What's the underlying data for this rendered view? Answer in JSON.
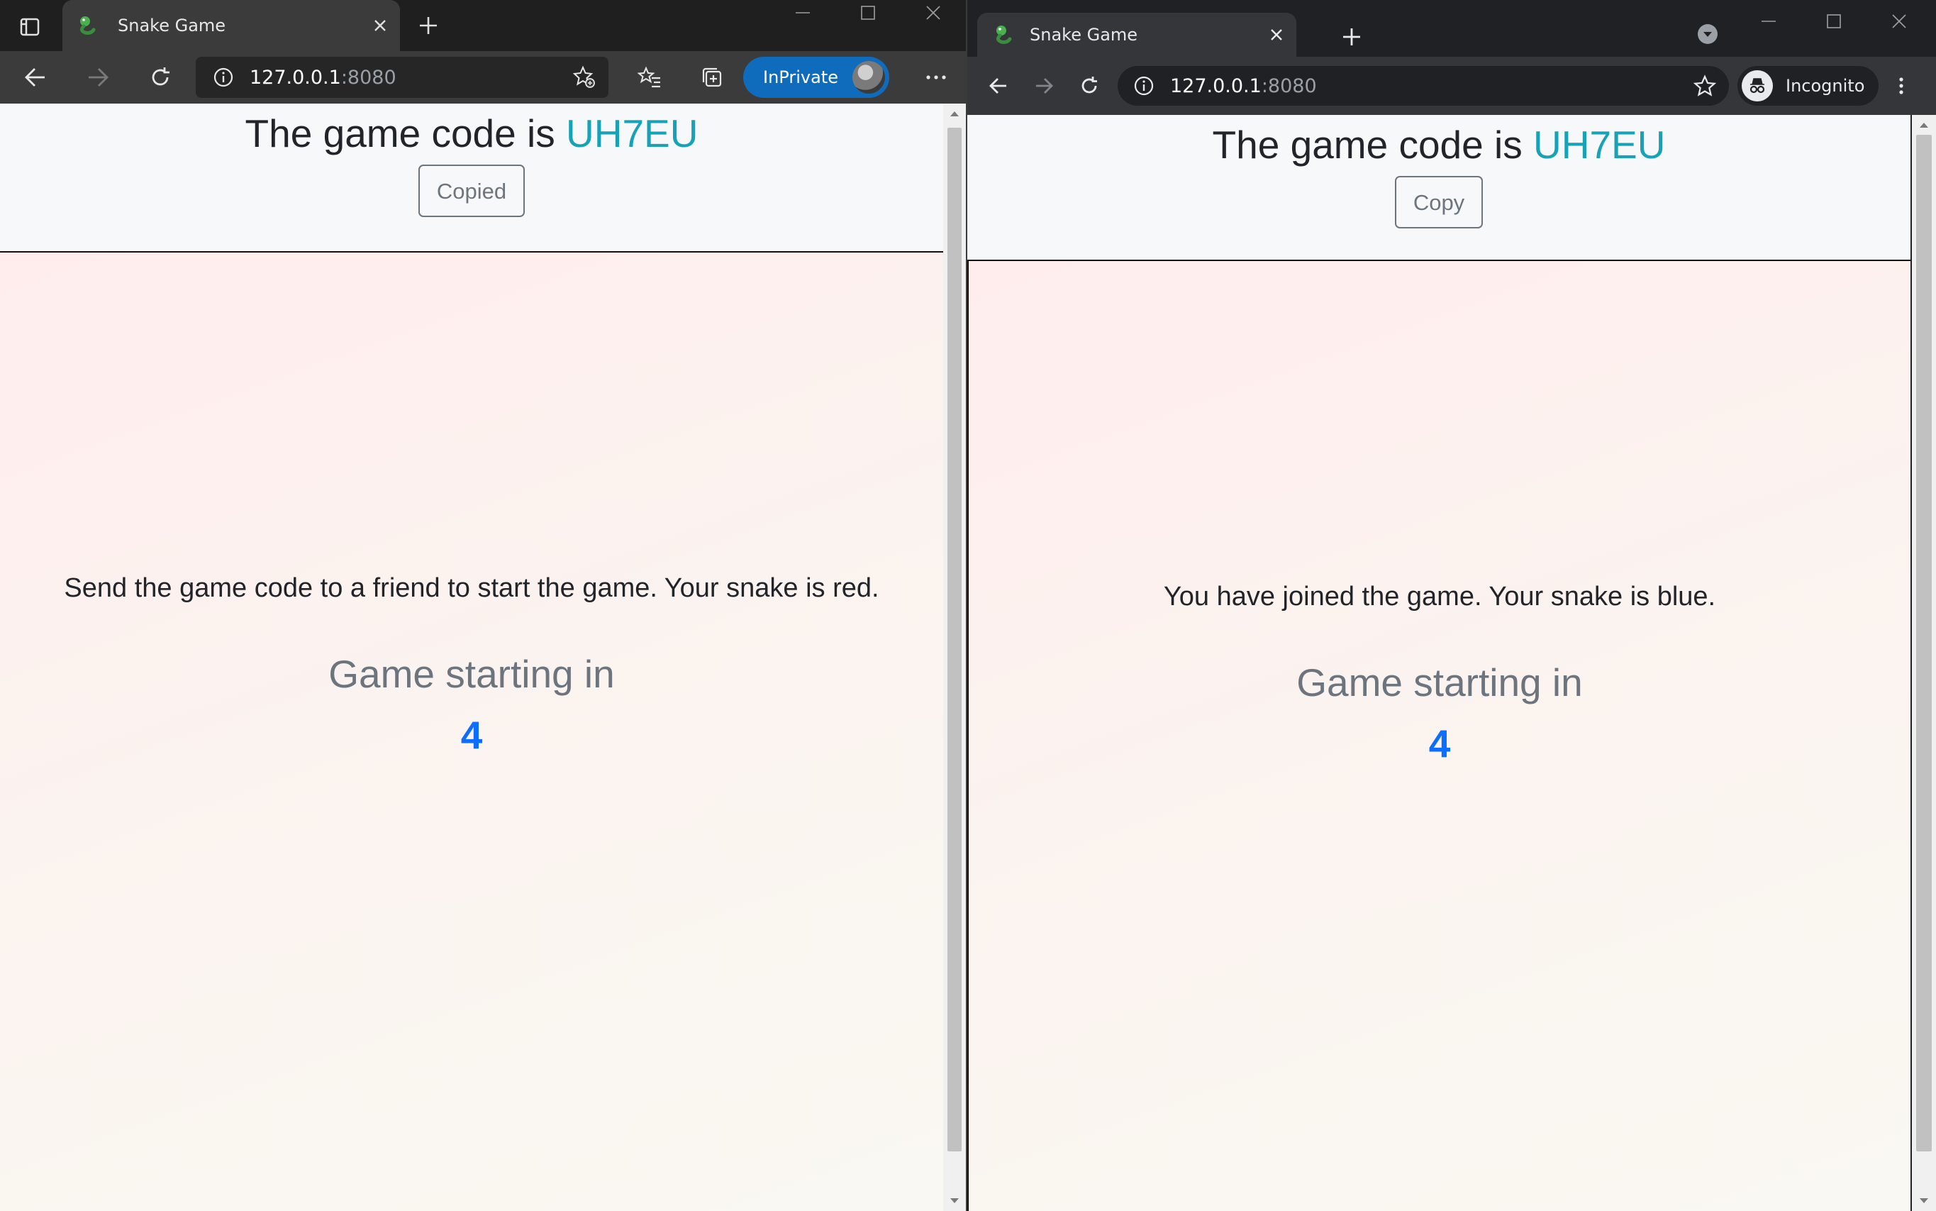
{
  "left": {
    "tab": {
      "title": "Snake Game"
    },
    "address": {
      "host": "127.0.0.1",
      "port": ":8080"
    },
    "inprivate_label": "InPrivate",
    "page": {
      "code_prefix": "The game code is",
      "code": "UH7EU",
      "copy_button": "Copied",
      "status": "Send the game code to a friend to start the game. Your snake is red.",
      "countdown_label": "Game starting in",
      "countdown": "4"
    }
  },
  "right": {
    "tab": {
      "title": "Snake Game"
    },
    "address": {
      "host": "127.0.0.1",
      "port": ":8080"
    },
    "incognito_label": "Incognito",
    "page": {
      "code_prefix": "The game code is",
      "code": "UH7EU",
      "copy_button": "Copy",
      "status": "You have joined the game. Your snake is blue.",
      "countdown_label": "Game starting in",
      "countdown": "4"
    }
  },
  "colors": {
    "code": "#17a2b8",
    "countdown": "#0d6efd",
    "inprivate_badge": "#0f6cbd"
  },
  "icons": [
    "tab-actions-icon",
    "snake-favicon",
    "close-icon",
    "plus-icon",
    "minimize-icon",
    "maximize-icon",
    "back-icon",
    "forward-icon",
    "refresh-icon",
    "info-icon",
    "add-favorite-icon",
    "favorites-icon",
    "collections-icon",
    "more-icon",
    "tab-search-icon",
    "star-icon",
    "incognito-icon",
    "kebab-menu-icon"
  ]
}
